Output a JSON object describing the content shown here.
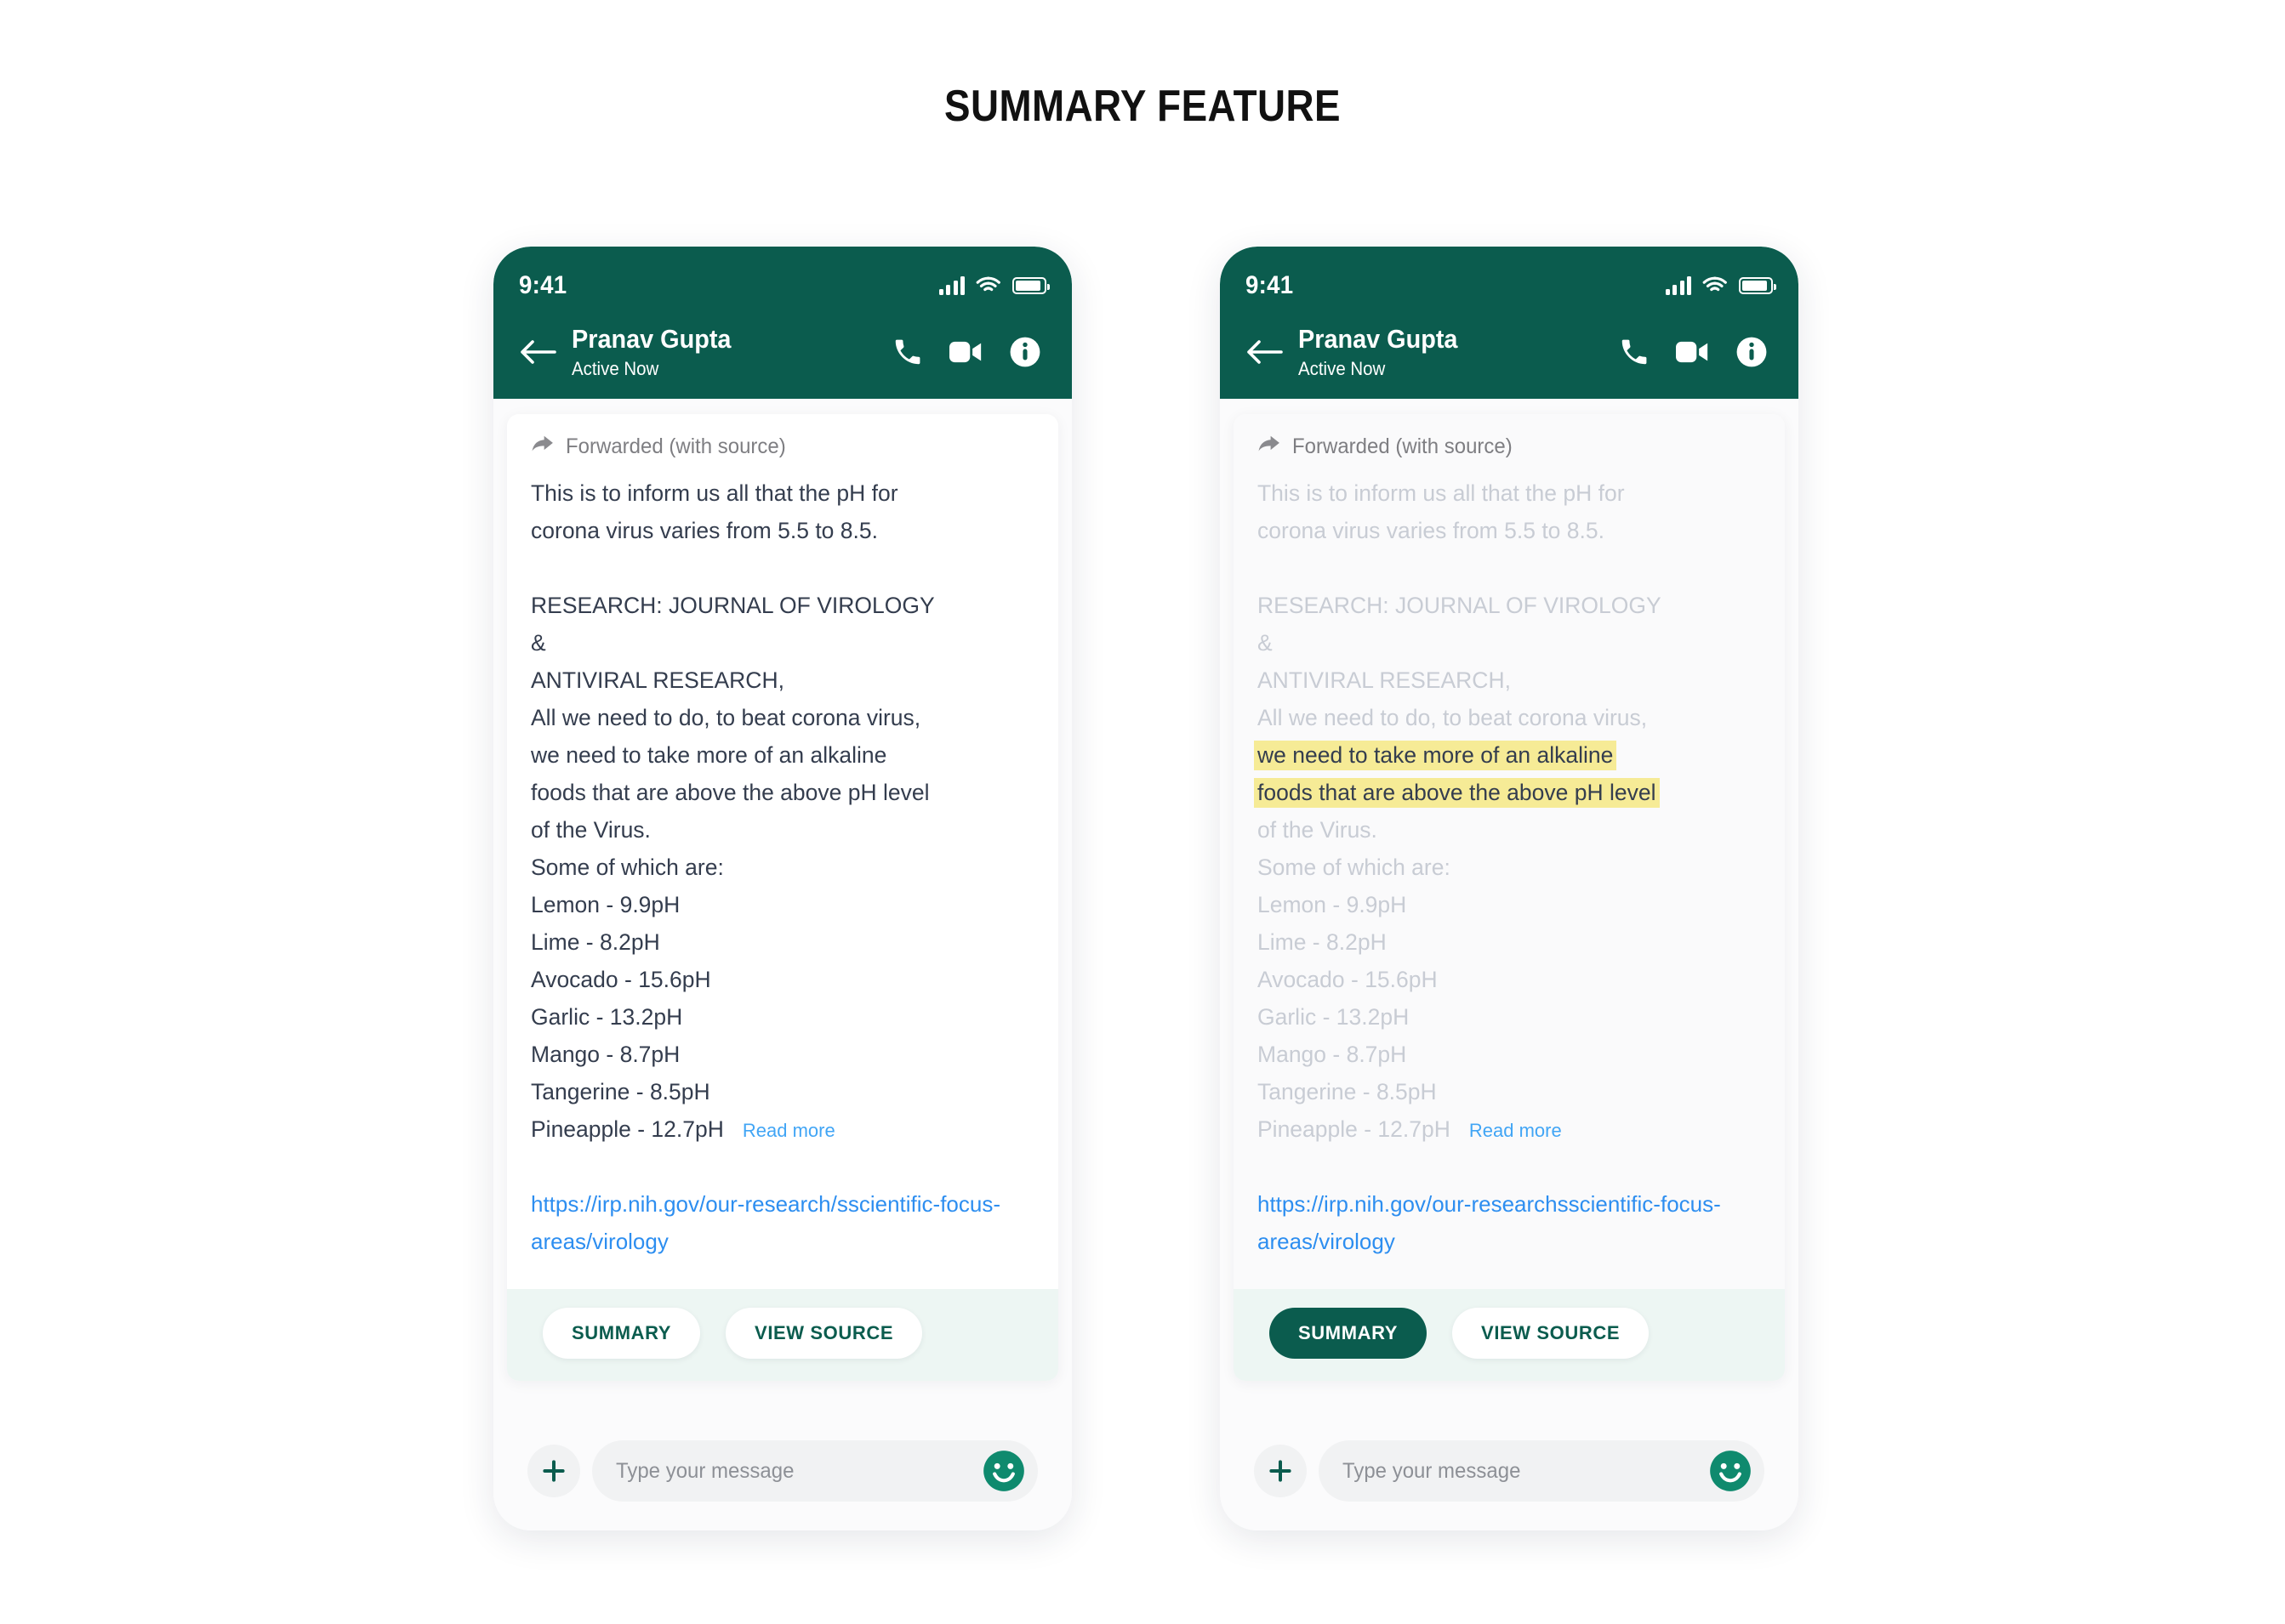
{
  "page": {
    "title": "SUMMARY FEATURE"
  },
  "colors": {
    "brand_green": "#0b5c4e",
    "emoji_green": "#0f8a6e",
    "link_blue": "#2d8ef0",
    "read_more_blue": "#41a5f5",
    "highlight_yellow": "#f6eb96",
    "muted_text": "#c8ccd4",
    "body_text": "#343d4e",
    "actions_bg": "#edf6f3"
  },
  "phones": [
    {
      "id": "phone-default",
      "status_bar": {
        "time": "9:41",
        "icons": [
          "signal-icon",
          "wifi-icon",
          "battery-icon"
        ]
      },
      "header": {
        "back_icon": "back-arrow-icon",
        "contact_name": "Pranav Gupta",
        "contact_status": "Active Now",
        "actions": [
          "phone-call-icon",
          "video-call-icon",
          "info-icon"
        ]
      },
      "message": {
        "forwarded_icon": "forward-arrow-icon",
        "forwarded_label": "Forwarded (with source)",
        "paragraph_1": "This is to inform us all that the pH for\ncorona virus varies from 5.5 to 8.5.",
        "paragraph_2_pre": "RESEARCH: JOURNAL OF VIROLOGY\n&\nANTIVIRAL RESEARCH,\nAll we need to do, to beat corona virus,\n",
        "paragraph_2_highlight": "we need to take more of an alkaline\nfoods that are above the above pH level",
        "paragraph_2_post": "\nof the Virus.\nSome of which are:\nLemon - 9.9pH\nLime - 8.2pH\nAvocado - 15.6pH\nGarlic - 13.2pH\nMango - 8.7pH\nTangerine - 8.5pH",
        "last_line": "Pineapple - 12.7pH",
        "read_more": "Read more",
        "link": "https://irp.nih.gov/our-research/sscientific-focus-areas/virology",
        "highlight_on": false
      },
      "actions": {
        "summary_label": "SUMMARY",
        "view_source_label": "VIEW SOURCE",
        "summary_active": false
      },
      "composer": {
        "plus_icon": "plus-icon",
        "placeholder": "Type your message",
        "emoji_icon": "smiley-icon"
      }
    },
    {
      "id": "phone-summary-active",
      "status_bar": {
        "time": "9:41",
        "icons": [
          "signal-icon",
          "wifi-icon",
          "battery-icon"
        ]
      },
      "header": {
        "back_icon": "back-arrow-icon",
        "contact_name": "Pranav Gupta",
        "contact_status": "Active Now",
        "actions": [
          "phone-call-icon",
          "video-call-icon",
          "info-icon"
        ]
      },
      "message": {
        "forwarded_icon": "forward-arrow-icon",
        "forwarded_label": "Forwarded (with source)",
        "paragraph_1": "This is to inform us all that the pH for\ncorona virus varies from 5.5 to 8.5.",
        "paragraph_2_pre": "RESEARCH: JOURNAL OF VIROLOGY\n&\nANTIVIRAL RESEARCH,\nAll we need to do, to beat corona virus,\n",
        "paragraph_2_highlight": "we need to take more of an alkaline\nfoods that are above the above pH level",
        "paragraph_2_post": "\nof the Virus.\nSome of which are:\nLemon - 9.9pH\nLime - 8.2pH\nAvocado - 15.6pH\nGarlic - 13.2pH\nMango - 8.7pH\nTangerine - 8.5pH",
        "last_line": "Pineapple - 12.7pH",
        "read_more": "Read more",
        "link": "https://irp.nih.gov/our-researchsscientific-focus-areas/virology",
        "highlight_on": true
      },
      "actions": {
        "summary_label": "SUMMARY",
        "view_source_label": "VIEW SOURCE",
        "summary_active": true
      },
      "composer": {
        "plus_icon": "plus-icon",
        "placeholder": "Type your message",
        "emoji_icon": "smiley-icon"
      }
    }
  ]
}
